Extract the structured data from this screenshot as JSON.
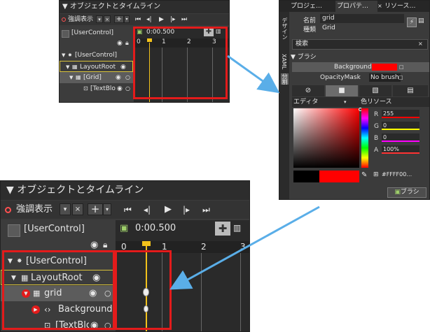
{
  "small_panel": {
    "title": "オブジェクトとタイムライン",
    "toolbar": {
      "state_label": "強調表示",
      "add_label": "+"
    },
    "tree": {
      "root_label": "[UserControl]",
      "time": "0:00.500",
      "rows": [
        {
          "label": "[UserControl]"
        },
        {
          "label": "LayoutRoot"
        },
        {
          "label": "[Grid]"
        },
        {
          "label": "[TextBlo"
        }
      ]
    },
    "ruler": [
      "0",
      "1",
      "2",
      "3"
    ]
  },
  "props_panel": {
    "tabs": [
      "プロジェ…",
      "プロパテ…",
      "リソース…"
    ],
    "vertical_tabs": [
      "デザイン",
      "XAML",
      "分割"
    ],
    "name_label": "名前",
    "name_value": "grid",
    "type_label": "種類",
    "type_value": "Grid",
    "search_placeholder": "検索",
    "section_title": "ブラシ",
    "background_label": "Background",
    "opacitymask_label": "OpacityMask",
    "opacitymask_value": "No brush",
    "editor_label": "エディタ",
    "color_resource_label": "色リソース",
    "r_label": "R",
    "r_value": "255",
    "g_label": "G",
    "g_value": "0",
    "b_label": "B",
    "b_value": "0",
    "a_label": "A",
    "a_value": "100%",
    "hex_value": "#FFFF00…",
    "brush_button": "ブラシ",
    "accent_color": "#ff0000"
  },
  "large_panel": {
    "title": "オブジェクトとタイムライン",
    "toolbar": {
      "state_label": "強調表示",
      "add_label": "+"
    },
    "tree": {
      "root_label": "[UserControl]",
      "time": "0:00.500",
      "rows": [
        {
          "label": "[UserControl]"
        },
        {
          "label": "LayoutRoot"
        },
        {
          "label": "grid"
        },
        {
          "label": "Background"
        },
        {
          "label": "[TextBlo"
        }
      ]
    },
    "ruler": [
      "0",
      "1",
      "2",
      "3"
    ]
  },
  "colors": {
    "highlight_border": "#e31b1b",
    "arrow": "#5aaee8",
    "playhead": "#f2c21b",
    "selection_outline": "#d8c23a"
  }
}
